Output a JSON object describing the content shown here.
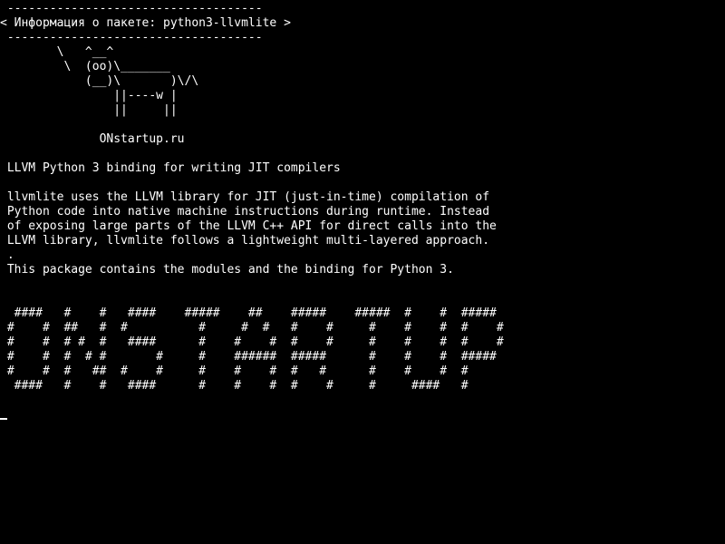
{
  "terminal": {
    "lines": [
      " ------------------------------------",
      "< Информация о пакете: python3-llvmlite >",
      " ------------------------------------",
      "        \\   ^__^",
      "         \\  (oo)\\_______",
      "            (__)\\       )\\/\\",
      "                ||----w |",
      "                ||     ||",
      "",
      "              ONstartup.ru",
      "",
      " LLVM Python 3 binding for writing JIT compilers",
      "",
      " llvmlite uses the LLVM library for JIT (just-in-time) compilation of",
      " Python code into native machine instructions during runtime. Instead",
      " of exposing large parts of the LLVM C++ API for direct calls into the",
      " LLVM library, llvmlite follows a lightweight multi-layered approach.",
      " .",
      " This package contains the modules and the binding for Python 3.",
      "",
      "",
      "  ####   #    #   ####    #####    ##    #####    #####  #    #  #####",
      " #    #  ##   #  #          #     #  #   #    #     #    #    #  #    #",
      " #    #  # #  #   ####      #    #    #  #    #     #    #    #  #    #",
      " #    #  #  # #       #     #    ######  #####      #    #    #  #####",
      " #    #  #   ##  #    #     #    #    #  #   #      #    #    #  #",
      "  ####   #    #   ####      #    #    #  #    #     #     ####   #"
    ]
  }
}
